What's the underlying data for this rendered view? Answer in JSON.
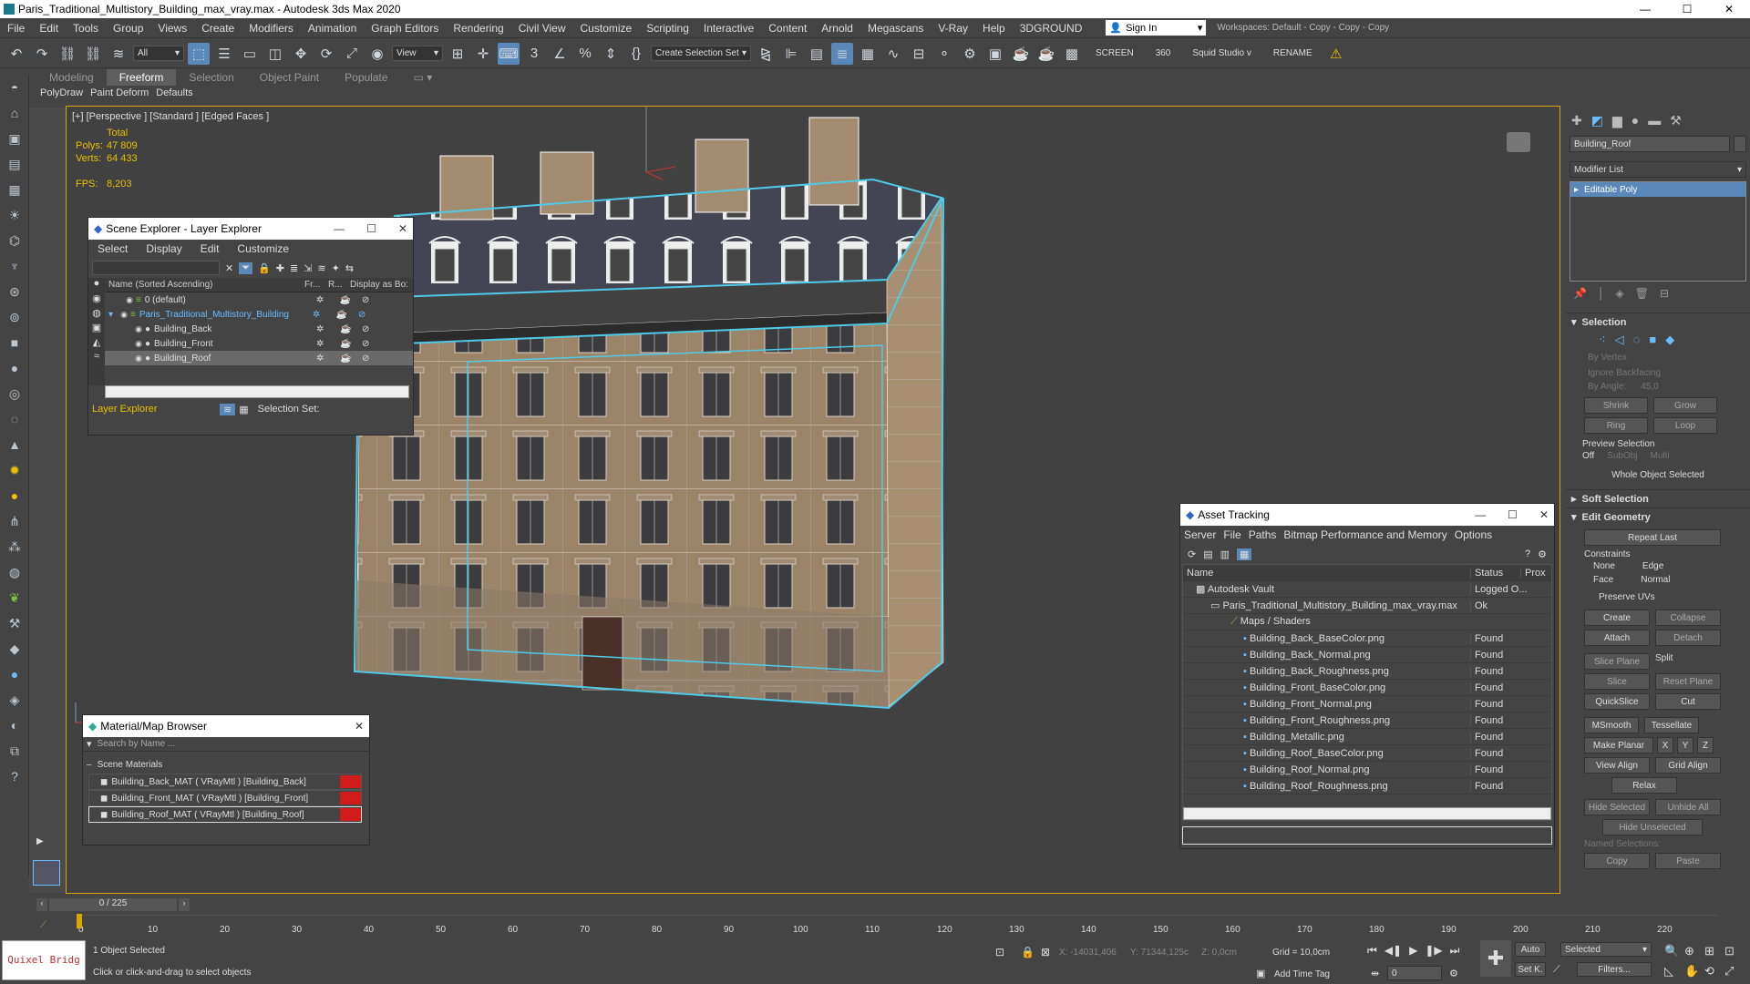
{
  "title": "Paris_Traditional_Multistory_Building_max_vray.max - Autodesk 3ds Max 2020",
  "menu": [
    "File",
    "Edit",
    "Tools",
    "Group",
    "Views",
    "Create",
    "Modifiers",
    "Animation",
    "Graph Editors",
    "Rendering",
    "Civil View",
    "Customize",
    "Scripting",
    "Interactive",
    "Content",
    "Arnold",
    "Megascans",
    "V-Ray",
    "Help",
    "3DGROUND"
  ],
  "signin": "Sign In",
  "workspaces": "Workspaces:  Default - Copy - Copy - Copy",
  "toolbar": {
    "filter": "All",
    "view": "View",
    "selset": "Create Selection Set",
    "screen": "SCREEN",
    "n360": "360",
    "squid": "Squid Studio v",
    "rename": "RENAME"
  },
  "ribbon": {
    "tabs": [
      "Modeling",
      "Freeform",
      "Selection",
      "Object Paint",
      "Populate"
    ],
    "sub": [
      "PolyDraw",
      "Paint Deform",
      "Defaults"
    ]
  },
  "viewport": {
    "label": "[+] [Perspective ] [Standard ] [Edged Faces ]",
    "total": "Total",
    "polys_k": "Polys:",
    "polys_v": "47 809",
    "verts_k": "Verts:",
    "verts_v": "64 433",
    "fps_k": "FPS:",
    "fps_v": "8,203"
  },
  "layer": {
    "title": "Scene Explorer - Layer Explorer",
    "menu": [
      "Select",
      "Display",
      "Edit",
      "Customize"
    ],
    "col_name": "Name (Sorted Ascending)",
    "col_fr": "Fr...",
    "col_r": "R...",
    "col_disp": "Display as Bo:",
    "rows": [
      "0 (default)",
      "Paris_Traditional_Multistory_Building",
      "Building_Back",
      "Building_Front",
      "Building_Roof"
    ],
    "footer_label": "Layer Explorer",
    "selset": "Selection Set:"
  },
  "matbrowser": {
    "title": "Material/Map Browser",
    "search": "Search by Name ...",
    "section": "Scene Materials",
    "items": [
      "Building_Back_MAT  ( VRayMtl ) [Building_Back]",
      "Building_Front_MAT  ( VRayMtl ) [Building_Front]",
      "Building_Roof_MAT  ( VRayMtl ) [Building_Roof]"
    ]
  },
  "asset": {
    "title": "Asset Tracking",
    "menu": [
      "Server",
      "File",
      "Paths",
      "Bitmap Performance and Memory",
      "Options"
    ],
    "col_name": "Name",
    "col_status": "Status",
    "col_prox": "Prox",
    "rows": [
      {
        "name": "Autodesk Vault",
        "status": "Logged O..."
      },
      {
        "name": "Paris_Traditional_Multistory_Building_max_vray.max",
        "status": "Ok"
      },
      {
        "name": "Maps / Shaders",
        "status": ""
      },
      {
        "name": "Building_Back_BaseColor.png",
        "status": "Found"
      },
      {
        "name": "Building_Back_Normal.png",
        "status": "Found"
      },
      {
        "name": "Building_Back_Roughness.png",
        "status": "Found"
      },
      {
        "name": "Building_Front_BaseColor.png",
        "status": "Found"
      },
      {
        "name": "Building_Front_Normal.png",
        "status": "Found"
      },
      {
        "name": "Building_Front_Roughness.png",
        "status": "Found"
      },
      {
        "name": "Building_Metallic.png",
        "status": "Found"
      },
      {
        "name": "Building_Roof_BaseColor.png",
        "status": "Found"
      },
      {
        "name": "Building_Roof_Normal.png",
        "status": "Found"
      },
      {
        "name": "Building_Roof_Roughness.png",
        "status": "Found"
      }
    ]
  },
  "cmd": {
    "object_name": "Building_Roof",
    "modlist": "Modifier List",
    "stack_item": "Editable Poly",
    "selection": "Selection",
    "by_vertex": "By Vertex",
    "ignore_bf": "Ignore Backfacing",
    "by_angle": "By Angle:",
    "angle_val": "45,0",
    "shrink": "Shrink",
    "grow": "Grow",
    "ring": "Ring",
    "loop": "Loop",
    "preview": "Preview Selection",
    "off": "Off",
    "subobj": "SubObj",
    "multi": "Multi",
    "whole": "Whole Object Selected",
    "soft": "Soft Selection",
    "editgeo": "Edit Geometry",
    "repeat": "Repeat Last",
    "constraints": "Constraints",
    "none": "None",
    "edge": "Edge",
    "face": "Face",
    "normal": "Normal",
    "preserve": "Preserve UVs",
    "create": "Create",
    "collapse": "Collapse",
    "attach": "Attach",
    "detach": "Detach",
    "sliceplane": "Slice Plane",
    "split": "Split",
    "slice": "Slice",
    "resetplane": "Reset Plane",
    "quickslice": "QuickSlice",
    "cut": "Cut",
    "msmooth": "MSmooth",
    "tessellate": "Tessellate",
    "makeplanar": "Make Planar",
    "x": "X",
    "y": "Y",
    "z": "Z",
    "viewalign": "View Align",
    "gridalign": "Grid Align",
    "relax": "Relax",
    "hidesel": "Hide Selected",
    "unhide": "Unhide All",
    "hideunsel": "Hide Unselected",
    "namedsel": "Named Selections:",
    "copy": "Copy",
    "paste": "Paste"
  },
  "bottom": {
    "frame": "0 / 225",
    "ticks": [
      "0",
      "10",
      "20",
      "30",
      "40",
      "50",
      "60",
      "70",
      "80",
      "90",
      "100",
      "110",
      "120",
      "130",
      "140",
      "150",
      "160",
      "170",
      "180",
      "190",
      "200",
      "210",
      "220"
    ],
    "quixel": "Quixel Bridg",
    "selected": "1 Object Selected",
    "hint": "Click or click-and-drag to select objects",
    "x": "X: -14031,406",
    "y": "Y: 71344,125c",
    "z": "Z: 0,0cm",
    "grid": "Grid = 10,0cm",
    "addtime": "Add Time Tag",
    "auto": "Auto",
    "setk": "Set K.",
    "seldrop": "Selected",
    "filters": "Filters...",
    "frameval": "0"
  },
  "colors": {
    "accent": "#5a88b8",
    "selection": "#4ecbe6",
    "viewport_border": "#d9a800",
    "stats": "#e6c200",
    "layer_hl": "#6bbcff"
  }
}
